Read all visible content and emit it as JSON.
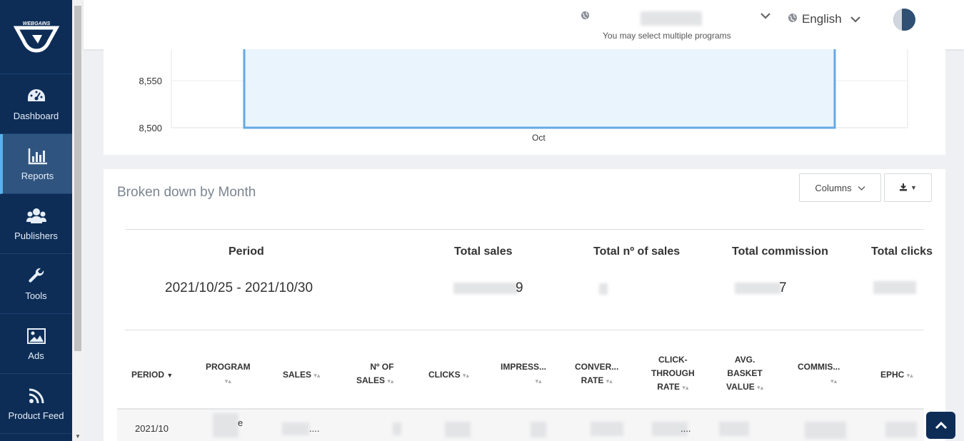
{
  "sidebar": {
    "brand": "WEBGAINS",
    "items": [
      {
        "label": "Dashboard",
        "icon": "dashboard-icon"
      },
      {
        "label": "Reports",
        "icon": "bar-chart-icon"
      },
      {
        "label": "Publishers",
        "icon": "users-icon"
      },
      {
        "label": "Tools",
        "icon": "wrench-icon"
      },
      {
        "label": "Ads",
        "icon": "image-icon"
      },
      {
        "label": "Product Feed",
        "icon": "rss-icon"
      }
    ],
    "active_item": "Reports"
  },
  "header": {
    "program_hint": "You may select multiple programs",
    "language": "English"
  },
  "chart": {
    "y_ticks": [
      "8,550",
      "8,500"
    ],
    "x_label": "Oct"
  },
  "chart_data": {
    "type": "bar",
    "categories": [
      "Oct"
    ],
    "values": [
      8620
    ],
    "ylim": [
      8500,
      8620
    ],
    "grid": true
  },
  "report": {
    "title": "Broken down by Month",
    "columns_button": "Columns",
    "summary": {
      "headers": [
        "Period",
        "Total sales",
        "Total nº of sales",
        "Total commission",
        "Total clicks"
      ],
      "period_value": "2021/10/25 - 2021/10/30",
      "sales_value_visible": "9",
      "commission_value_visible": "7"
    },
    "table_headers": {
      "period": "PERIOD",
      "program": "PROGRAM",
      "sales": "SALES",
      "num_sales_1": "Nº OF",
      "num_sales_2": "SALES",
      "clicks": "CLICKS",
      "impressions": "IMPRESS...",
      "conv_1": "CONVER...",
      "conv_2": "RATE",
      "ctr_1": "CLICK-",
      "ctr_2": "THROUGH",
      "ctr_3": "RATE",
      "avg_1": "AVG.",
      "avg_2": "BASKET",
      "avg_3": "VALUE",
      "commission": "COMMIS...",
      "ephc": "EPHC"
    },
    "rows": [
      {
        "period": "2021/10",
        "program_tail": "e",
        "sales_tail": "....",
        "ctr_tail": "...."
      }
    ]
  },
  "colors": {
    "sidebar_bg": "#0d2d57",
    "active_accent": "#58b2ec",
    "bar_border": "#64a9e4",
    "bar_fill": "#eaf4fd"
  }
}
